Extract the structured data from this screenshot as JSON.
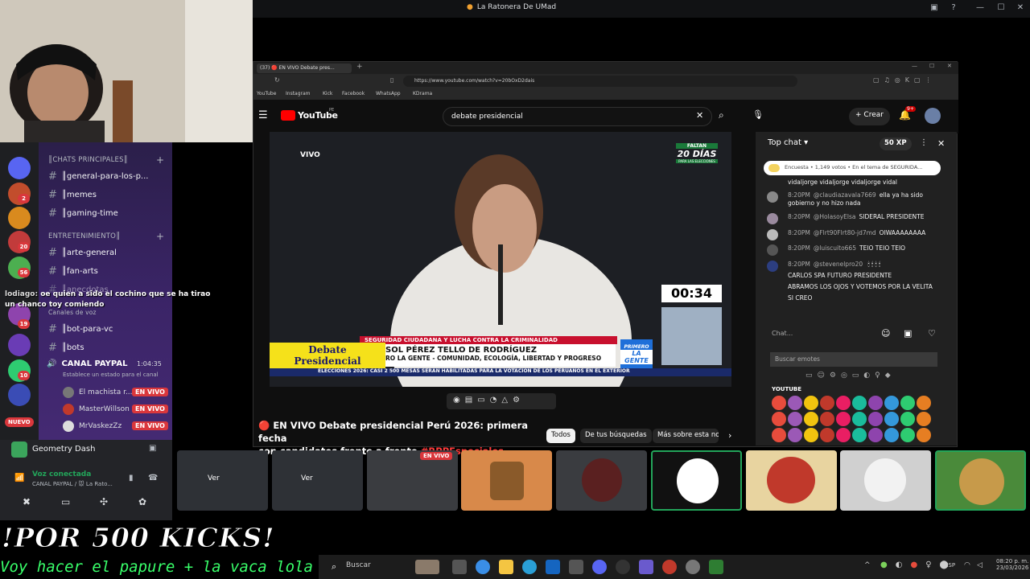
{
  "window_title": "La Ratonera De UMad",
  "webcam": {
    "label": "webcam"
  },
  "discord": {
    "categories": {
      "main": "║CHATS PRINCIPALES║",
      "entertainment": "ENTRETENIMIENTO║",
      "voice": "Canales de voz"
    },
    "channels": [
      {
        "name": "║general-para-los-p..."
      },
      {
        "name": "║memes"
      },
      {
        "name": "║gaming-time"
      },
      {
        "name": "║arte-general"
      },
      {
        "name": "║fan-arts"
      },
      {
        "name": "║anecdotas"
      },
      {
        "name": "║bot-para-vc"
      },
      {
        "name": "║bots"
      }
    ],
    "overlay_chat": {
      "user": "lodiago:",
      "text": "oe quien a sido el cochino que se ha tirao un chanco toy comiendo"
    },
    "voice_channel": {
      "name": "CANAL PAYPAL",
      "time": "1:04:35",
      "status": "Establece un estado para el canal"
    },
    "members": [
      {
        "name": "El machista r...",
        "badge": "EN VIVO"
      },
      {
        "name": "MasterWillson",
        "badge": "EN VIVO"
      },
      {
        "name": "MrVaskezZz",
        "badge": "EN VIVO"
      }
    ],
    "guild_badges": [
      "2",
      "20",
      "56",
      "19",
      "10"
    ],
    "new_badge": "NUEVO",
    "activity": "Geometry Dash",
    "voice": {
      "status": "Voz conectada",
      "channel": "CANAL PAYPAL / 🐭 La Rato..."
    }
  },
  "browser": {
    "tab_title": "(37) 🔴 EN VIVO Debate pres...",
    "url": "https://www.youtube.com/watch?v=20bOxD2dais",
    "bookmarks": [
      "YouTube",
      "Instagram",
      "Kick",
      "Facebook",
      "WhatsApp",
      "KDrama"
    ],
    "youtube": {
      "logo": "YouTube",
      "country": "PE",
      "search_value": "debate presidencial",
      "create_label": "Crear",
      "notif_count": "9+",
      "video": {
        "live_label": "VIVO",
        "faltan": "FALTAN",
        "days": "20 DÍAS",
        "para": "PARA LAS ELECCIONES",
        "countdown": "00:34",
        "band_title": "SEGURIDAD CIUDADANA Y LUCHA CONTRA LA CRIMINALIDAD",
        "debate_label_1": "Debate",
        "debate_label_2": "Presidencial",
        "candidate": "SOL PÉREZ TELLO DE RODRÍGUEZ",
        "party": "RO LA GENTE - COMUNIDAD, ECOLOGÍA, LIBERTAD Y PROGRESO",
        "party_logo_1": "PRIMERO",
        "party_logo_2": "LA GENTE",
        "ticker": "ELECCIONES 2026: CASI 2 500 MESAS SERÁN HABILITADAS PARA LA VOTACIÓN DE LOS PERUANOS EN EL EXTERIOR"
      },
      "video_title_line1": "🔴 EN VIVO Debate presidencial Perú 2026: primera fecha",
      "video_title_line2": "con candidatos frente a frente",
      "hashtag": "#RPPEspeciales",
      "chips": [
        "Todos",
        "De tus búsquedas",
        "Más sobre esta no"
      ],
      "chat": {
        "header": "Top chat",
        "xp": "50 XP",
        "poll": "Encuesta • 1,149 votos • En el tema de SEGURIDA...",
        "messages": [
          {
            "time": "",
            "user": "",
            "text": "vidaljorge vidaljorge vidaljorge vidal"
          },
          {
            "time": "8:20PM",
            "user": "@claudiazavala7669",
            "text": "ella ya ha sido gobierno y no hizo nada"
          },
          {
            "time": "8:20PM",
            "user": "@HolasoyElsa",
            "text": "SIDERAL PRESIDENTE"
          },
          {
            "time": "8:20PM",
            "user": "@Flrt90Flrt80-jd7md",
            "text": "OIWAAAAAAAA"
          },
          {
            "time": "8:20PM",
            "user": "@luiscuito665",
            "text": "TEIO TEIO TEIO"
          },
          {
            "time": "8:20PM",
            "user": "@stevenelpro20",
            "text": "CARLOS SPA FUTURO PRESIDENTE"
          },
          {
            "time": "",
            "user": "",
            "text": "ABRAMOS LOS OJOS Y VOTEMOS POR LA VELITA"
          },
          {
            "time": "",
            "user": "",
            "text": "SI CREO"
          }
        ],
        "input_placeholder": "Chat...",
        "emote_search": "Buscar emotes",
        "emote_section": "YOUTUBE"
      }
    }
  },
  "tiles": [
    {
      "label": "Ver"
    },
    {
      "label": "Ver"
    },
    {
      "label": "EN VIVO"
    }
  ],
  "overlay": {
    "kicks": "!POR 500 KICKS!",
    "papure": "Voy hacer el papure + la vaca lola"
  },
  "taskbar": {
    "search_placeholder": "Buscar",
    "lang": "ESP",
    "time": "08:20 p. m.",
    "date": "23/03/2026"
  }
}
